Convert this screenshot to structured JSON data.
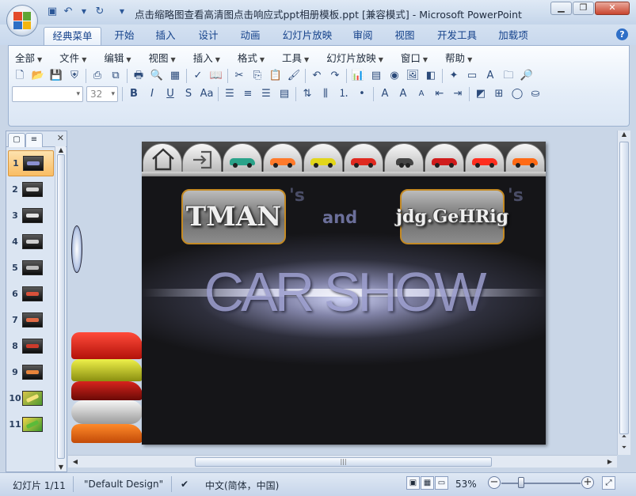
{
  "window": {
    "title": "点击缩略图查看高清图点击响应式ppt相册模板.ppt [兼容模式] - Microsoft PowerPoint",
    "minimize_icon": "minimize-icon",
    "maximize_icon": "restore-icon",
    "close_icon": "close-icon"
  },
  "ribbon_tabs": [
    "经典菜单",
    "开始",
    "插入",
    "设计",
    "动画",
    "幻灯片放映",
    "审阅",
    "视图",
    "开发工具",
    "加载项"
  ],
  "active_tab": "经典菜单",
  "menu": [
    "全部",
    "文件",
    "编辑",
    "视图",
    "插入",
    "格式",
    "工具",
    "幻灯片放映",
    "窗口",
    "帮助"
  ],
  "font_size_value": "32",
  "slides": [
    "1",
    "2",
    "3",
    "4",
    "5",
    "6",
    "7",
    "8",
    "9",
    "10",
    "11"
  ],
  "selected_slide": "1",
  "slide_content": {
    "left_badge": "TMAN",
    "right_badge": "jdg.GeHRig",
    "apostrophe_left": "'s",
    "apostrophe_right": "'s",
    "connector": "and",
    "headline": "CAR SHOW"
  },
  "status": {
    "slide_counter": "幻灯片 1/11",
    "theme": "\"Default Design\"",
    "language": "中文(简体，中国)",
    "zoom": "53%"
  },
  "colors": {
    "accent": "#15428b",
    "badge_border": "#c48a24",
    "selected_thumb": "#f9bd63"
  }
}
